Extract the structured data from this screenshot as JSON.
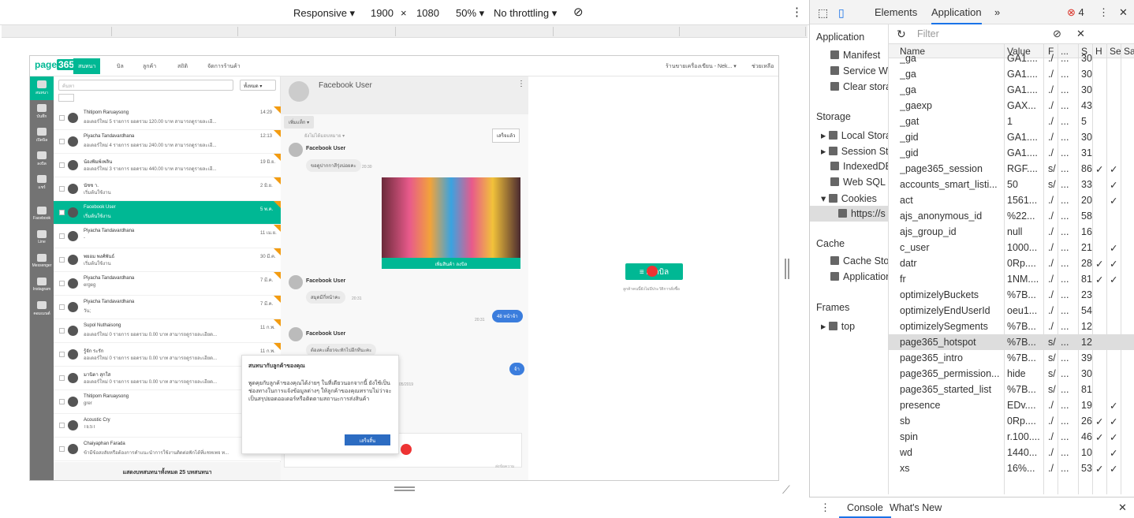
{
  "devbar": {
    "device": "Responsive ▾",
    "width": "1900",
    "x": "×",
    "height": "1080",
    "zoom": "50% ▾",
    "throttle": "No throttling ▾",
    "rotate": "⊘",
    "more": "⋮"
  },
  "app": {
    "logo": "page365",
    "nav": [
      "สนทนา",
      "บิล",
      "ลูกค้า",
      "สถิติ",
      "จัดการร้านค้า"
    ],
    "shop": "ร้านขายเครื่องเขียน - Nek... ▾",
    "help": "ช่วยเหลือ",
    "rail": [
      "สนทนา",
      "บันทึก",
      "เปิดบิล",
      "ลงบิล",
      "แชร์",
      "Facebook",
      "Line",
      "Messenger",
      "Instagram",
      "คอมเมนต์"
    ],
    "search_placeholder": "ค้นหา",
    "filter": "ทั้งหมด ▾",
    "rows": [
      {
        "name": "Thitipom Raruaysong",
        "preview": "ออเดอร์ใหม่ 5 รายการ ยอดรวม 120.00 บาท สามารถดูรายละเอี...",
        "time": "14:29"
      },
      {
        "name": "Piyacha Tandavardhana",
        "preview": "ออเดอร์ใหม่ 4 รายการ ยอดรวม 240.00 บาท สามารถดูรายละเอี...",
        "time": "12:13"
      },
      {
        "name": "น้องพิมพ์เพลิน",
        "preview": "ออเดอร์ใหม่ 3 รายการ ยอดรวม 440.00 บาท สามารถดูรายละเอี...",
        "time": "19 มิ.ย."
      },
      {
        "name": "นัชช า.",
        "preview": "เริ่มต้นใช้งาน",
        "time": "2 มิ.ย."
      },
      {
        "name": "Facebook User",
        "preview": "เริ่มต้นใช้งาน",
        "time": "5 พ.ค."
      },
      {
        "name": "Piyacha Tandavardhana",
        "preview": "-",
        "time": "11 เม.ย."
      },
      {
        "name": "พยอม พงศ์พันธ์",
        "preview": "เริ่มต้นใช้งาน",
        "time": "30 มี.ค."
      },
      {
        "name": "Piyacha Tandavardhana",
        "preview": "ergeg",
        "time": "7 มี.ค."
      },
      {
        "name": "Piyacha Tandavardhana",
        "preview": "วัน;",
        "time": "7 มี.ค."
      },
      {
        "name": "Supol Nuthaisong",
        "preview": "ออเดอร์ใหม่ 0 รายการ ยอดรวม 0.00 บาท สามารถดูรายละเอียด...",
        "time": "11 ก.พ."
      },
      {
        "name": "รู้จัก ระรัก",
        "preview": "ออเดอร์ใหม่ 0 รายการ ยอดรวม 0.00 บาท สามารถดูรายละเอียด...",
        "time": "11 ก.พ."
      },
      {
        "name": "มานิดา สุกใส",
        "preview": "ออเดอร์ใหม่ 0 รายการ ยอดรวม 0.00 บาท สามารถดูรายละเอียด...",
        "time": ""
      },
      {
        "name": "Thitipom Raruaysong",
        "preview": "grer",
        "time": "2"
      },
      {
        "name": "Acoustic Cry",
        "preview": "TEST",
        "time": "2"
      },
      {
        "name": "Chaiyaphan Farada",
        "preview": "ข้ามีข้อสงสัยหรือต้องการคำแนะนำการใช้งานติดต่อฟักได้ที่แชทเพจ ท...",
        "time": "29 ธ."
      }
    ],
    "total": "แสดงบทสนทนาทั้งหมด 25 บทสนทนา",
    "chat": {
      "name": "Facebook User",
      "tag": "เพิ่มแท็ก ▾",
      "assign": "ยังไม่ได้มอบหมาย ▾",
      "done": "เสร็จแล้ว",
      "sender": "Facebook User",
      "m1": "ขอดูปากกาสีรุ่งน่อยคะ",
      "m1t": "20:30",
      "prod": "เพิ่มสินค้า ลงบิล",
      "m2": "สมุดมีกี่หน้าคะ",
      "m2t": "20:31",
      "me1": "48 หน้าจ้า",
      "me1t": "20:31",
      "m3": "ต้องคะเดี๋ยวจะทักไปอีกทีนะคะ",
      "m3t": "20:32",
      "me2": "จ้า",
      "me2t": "20:32",
      "date": "05/2019",
      "input_ph": "ส่งข้อความ"
    },
    "popup": {
      "title": "สนทนากับลูกค้าของคุณ",
      "body": "พูดคุยกับลูกค้าของคุณได้ง่ายๆ ในที่เดียวนอกจากนี้ ยังใช้เป็นช่องทางในการแจ้งข้อมูลต่างๆ ให้ลูกค้าของคุณทราบไม่ว่าจะเป็นสรุปยอดออเดอร์หรือติดตามสถานะการส่งสินค้า",
      "btn": "เสร็จสิ้น"
    },
    "bill": {
      "btn": "≡ เปิดบิล",
      "hint": "ลูกค้าคนนี้ยังไม่มีประวัติการสั่งซื้อ"
    }
  },
  "devtools": {
    "tabs": [
      "Elements",
      "Application",
      "»"
    ],
    "errors": "4",
    "side": {
      "application": "Application",
      "manifest": "Manifest",
      "sw": "Service Wo",
      "clear": "Clear stora",
      "storage": "Storage",
      "local": "Local Stora",
      "session": "Session St",
      "indexed": "IndexedDB",
      "websql": "Web SQL",
      "cookies": "Cookies",
      "cookie_url": "https://s",
      "cache": "Cache",
      "cachestore": "Cache Sto",
      "appcache": "Application",
      "frames": "Frames",
      "top": "top"
    },
    "filter_ph": "Filter",
    "cols": [
      "Name",
      "Value",
      "F",
      "...",
      "S",
      "H",
      "Se",
      "Sa"
    ],
    "rows": [
      [
        "_ga",
        "GA1....",
        "./",
        "...",
        "30",
        "",
        ""
      ],
      [
        "_ga",
        "GA1....",
        "./",
        "...",
        "30",
        "",
        ""
      ],
      [
        "_ga",
        "GA1....",
        "./",
        "...",
        "30",
        "",
        ""
      ],
      [
        "_gaexp",
        "GAX...",
        "./",
        "...",
        "43",
        "",
        ""
      ],
      [
        "_gat",
        "1",
        "./",
        "...",
        "5",
        "",
        ""
      ],
      [
        "_gid",
        "GA1....",
        "./",
        "...",
        "30",
        "",
        ""
      ],
      [
        "_gid",
        "GA1....",
        "./",
        "...",
        "31",
        "",
        ""
      ],
      [
        "_page365_session",
        "RGF....",
        "s/",
        "...",
        "86",
        "✓",
        "✓"
      ],
      [
        "accounts_smart_listi...",
        "50",
        "s/",
        "...",
        "33",
        "",
        "✓"
      ],
      [
        "act",
        "1561...",
        "./",
        "...",
        "20",
        "",
        "✓"
      ],
      [
        "ajs_anonymous_id",
        "%22...",
        "./",
        "...",
        "58",
        "",
        ""
      ],
      [
        "ajs_group_id",
        "null",
        "./",
        "...",
        "16",
        "",
        ""
      ],
      [
        "c_user",
        "1000...",
        "./",
        "...",
        "21",
        "",
        "✓"
      ],
      [
        "datr",
        "0Rp....",
        "./",
        "...",
        "28",
        "✓",
        "✓"
      ],
      [
        "fr",
        "1NM....",
        "./",
        "...",
        "81",
        "✓",
        "✓"
      ],
      [
        "optimizelyBuckets",
        "%7B...",
        "./",
        "...",
        "23",
        "",
        ""
      ],
      [
        "optimizelyEndUserId",
        "oeu1...",
        "./",
        "...",
        "54",
        "",
        ""
      ],
      [
        "optimizelySegments",
        "%7B...",
        "./",
        "...",
        "12",
        "",
        ""
      ],
      [
        "page365_hotspot",
        "%7B...",
        "s/",
        "...",
        "12",
        "",
        ""
      ],
      [
        "page365_intro",
        "%7B...",
        "s/",
        "...",
        "39",
        "",
        ""
      ],
      [
        "page365_permission...",
        "hide",
        "s/",
        "...",
        "30",
        "",
        ""
      ],
      [
        "page365_started_list",
        "%7B...",
        "s/",
        "...",
        "81",
        "",
        ""
      ],
      [
        "presence",
        "EDv....",
        "./",
        "...",
        "19",
        "",
        "✓"
      ],
      [
        "sb",
        "0Rp....",
        "./",
        "...",
        "26",
        "✓",
        "✓"
      ],
      [
        "spin",
        "r.100....",
        "./",
        "...",
        "46",
        "✓",
        "✓"
      ],
      [
        "wd",
        "1440...",
        "./",
        "...",
        "10",
        "",
        "✓"
      ],
      [
        "xs",
        "16%...",
        "./",
        "...",
        "53",
        "✓",
        "✓"
      ]
    ],
    "console": "Console",
    "whatsnew": "What's New"
  }
}
